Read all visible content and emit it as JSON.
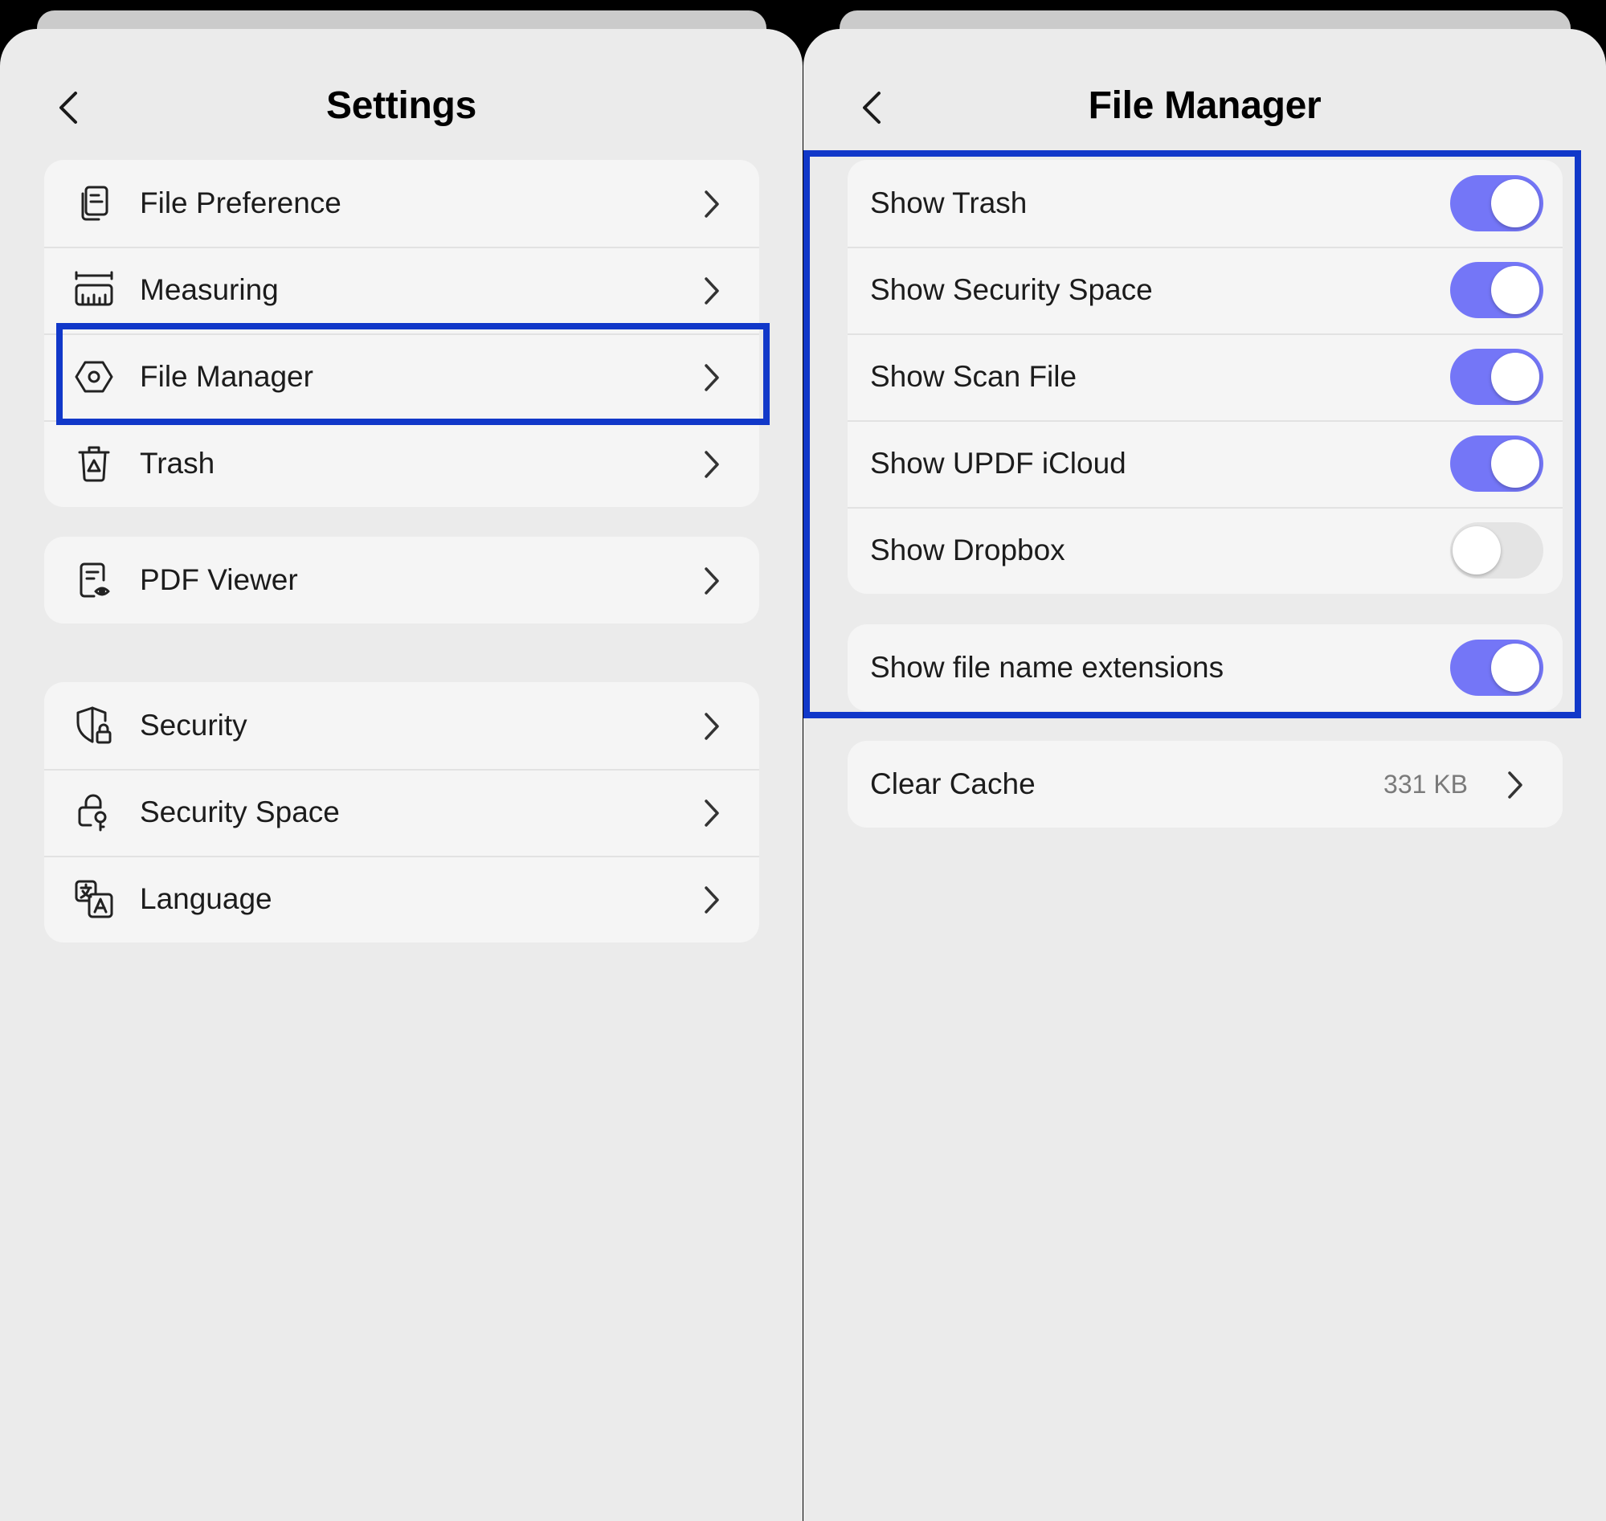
{
  "settings": {
    "title": "Settings",
    "groups": [
      {
        "items": [
          {
            "label": "File Preference",
            "icon": "file-preference-icon"
          },
          {
            "label": "Measuring",
            "icon": "ruler-icon"
          },
          {
            "label": "File Manager",
            "icon": "hexagon-gear-icon"
          },
          {
            "label": "Trash",
            "icon": "trash-icon"
          }
        ]
      },
      {
        "items": [
          {
            "label": "PDF Viewer",
            "icon": "pdf-viewer-icon"
          }
        ]
      },
      {
        "items": [
          {
            "label": "Security",
            "icon": "shield-lock-icon"
          },
          {
            "label": "Security Space",
            "icon": "lock-key-icon"
          },
          {
            "label": "Language",
            "icon": "translate-icon"
          }
        ]
      }
    ]
  },
  "file_manager": {
    "title": "File Manager",
    "toggles": [
      {
        "label": "Show Trash",
        "on": true
      },
      {
        "label": "Show Security Space",
        "on": true
      },
      {
        "label": "Show Scan File",
        "on": true
      },
      {
        "label": "Show UPDF iCloud",
        "on": true
      },
      {
        "label": "Show Dropbox",
        "on": false
      }
    ],
    "extensions": {
      "label": "Show file name extensions",
      "on": true
    },
    "cache": {
      "label": "Clear Cache",
      "value": "331 KB"
    }
  },
  "colors": {
    "toggle_on": "#7476f7",
    "toggle_off": "#e4e4e4",
    "highlight": "#1138c9",
    "panel_bg": "#ebebeb",
    "row_bg": "#f5f5f5"
  }
}
